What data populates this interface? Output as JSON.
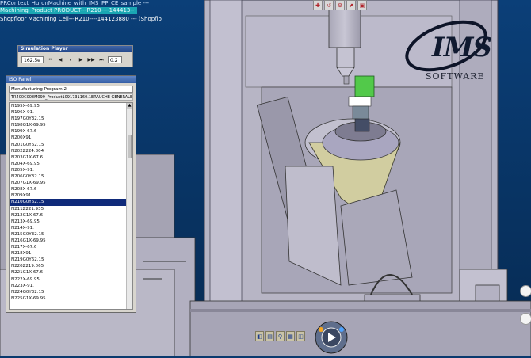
{
  "tree": {
    "line1": "PRContext_HuronMachine_with_IMS_PP_CE_sample ---",
    "line2": "Machining_Product PRODUCT---R210----144413--",
    "line3": "Shopfloor Machining Cell---R210----144123880 --- (Shopflo"
  },
  "sim_player": {
    "title": "Simulation Player",
    "value": "162.5e",
    "speed": "0.2",
    "buttons": [
      "⏮",
      "◀",
      "⏸",
      "▶",
      "▶▶",
      "⏭"
    ]
  },
  "iso_panel": {
    "title": "ISO Panel",
    "program": "Manufacturing Program.2",
    "path": "TR400C008M099_Product1091731160.1ERAUCHE GENERALE",
    "rows": [
      "N195X-69.95",
      "N196X-91.",
      "N197G0Y32.15",
      "N198G1X-69.95",
      "N199X-67.6",
      "N200X91.",
      "N201G0Y62.15",
      "N202Z224.804",
      "N203G1X-67.6",
      "N204X-69.95",
      "N205X-91.",
      "N206G0Y32.15",
      "N207G1X-69.95",
      "N208X-67.6",
      "N209X91.",
      "N210G0Y62.15",
      "N211Z221.935",
      "N212G1X-67.6",
      "N213X-69.95",
      "N214X-91.",
      "N215G0Y32.15",
      "N216G1X-69.95",
      "N217X-67.6",
      "N218X91.",
      "N219G0Y62.15",
      "N220Z219.065",
      "N221G1X-67.6",
      "N222X-69.95",
      "N223X-91.",
      "N224G0Y32.15",
      "N225G1X-69.95"
    ],
    "selected_index": 15
  },
  "logo": {
    "main": "IMS",
    "sub": "SOFTWARE"
  },
  "icons": {
    "compass": "compass-icon",
    "play": "play-icon"
  },
  "colors": {
    "background": "#0a3a6e",
    "machine": "#b9b7c6",
    "fixture": "#ccc9a2",
    "highlight": "#1aa7b3",
    "selection": "#0f2a7a"
  }
}
